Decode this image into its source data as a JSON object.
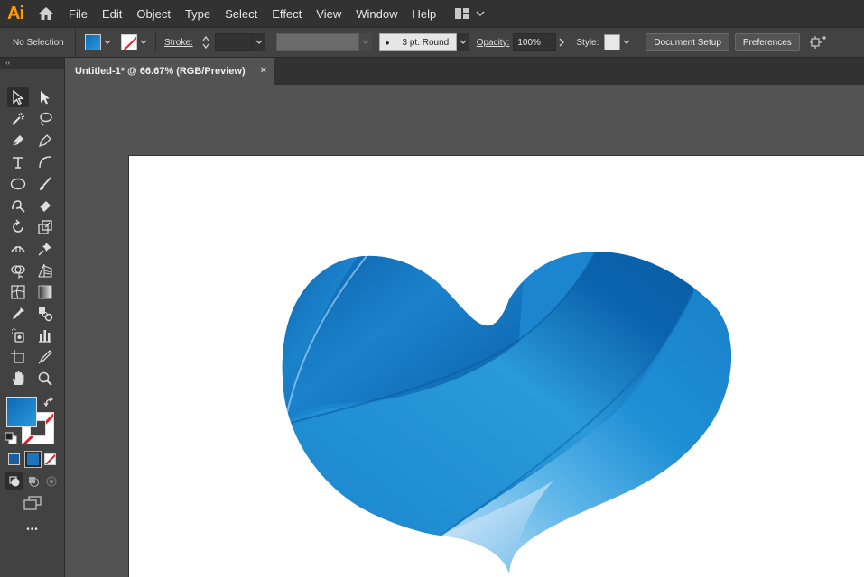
{
  "app": {
    "logo_text": "Ai"
  },
  "menubar": {
    "items": [
      "File",
      "Edit",
      "Object",
      "Type",
      "Select",
      "Effect",
      "View",
      "Window",
      "Help"
    ],
    "workspace_icon": "workspace-switcher-icon"
  },
  "controlbar": {
    "selection_label": "No Selection",
    "stroke_label": "Stroke:",
    "brush_value": "3 pt. Round",
    "opacity_label": "Opacity:",
    "opacity_value": "100%",
    "style_label": "Style:",
    "document_setup_label": "Document Setup",
    "preferences_label": "Preferences"
  },
  "document": {
    "tab_title": "Untitled-1* @ 66.67% (RGB/Preview)",
    "close_glyph": "×"
  },
  "toolspanel": {
    "collapse_glyph": "‹‹",
    "more_glyph": "•••"
  },
  "colors": {
    "accent": "#2a9ad8",
    "heart_dark": "#0a5fa8",
    "heart_mid": "#1e8fd3",
    "heart_light": "#cfe6f7"
  }
}
